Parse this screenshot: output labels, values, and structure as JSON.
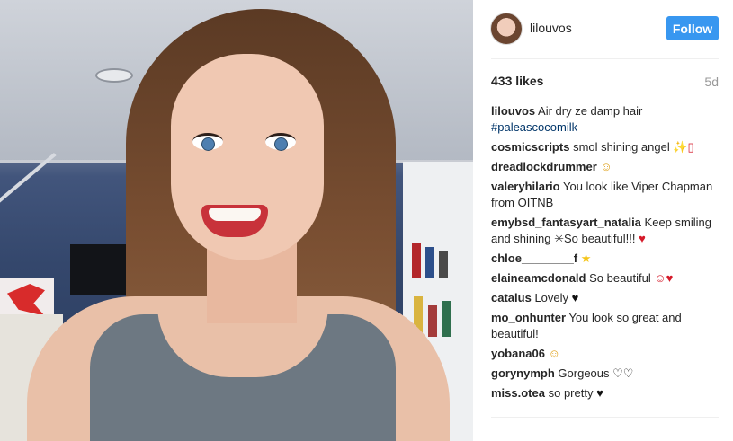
{
  "post": {
    "username": "lilouvos",
    "follow_label": "Follow",
    "likes": "433 likes",
    "age": "5d",
    "caption_user": "lilouvos",
    "caption_text": "Air dry ze damp hair",
    "hashtag": "#paleascocomilk"
  },
  "comments": [
    {
      "user": "cosmicscripts",
      "text": "smol shining angel",
      "emoji": "✨▯",
      "emoji_class": "emoji-heart"
    },
    {
      "user": "dreadlockdrummer",
      "text": "",
      "emoji": "☺",
      "emoji_class": "emoji-smile"
    },
    {
      "user": "valeryhilario",
      "text": "You look like Viper Chapman from OITNB",
      "emoji": "",
      "emoji_class": ""
    },
    {
      "user": "emybsd_fantasyart_natalia",
      "text": "Keep smiling and shining ✳So beautiful!!!",
      "emoji": "♥",
      "emoji_class": "emoji-heart"
    },
    {
      "user": "chloe________f",
      "text": "",
      "emoji": "★",
      "emoji_class": "emoji-star"
    },
    {
      "user": "elaineamcdonald",
      "text": "So beautiful",
      "emoji": "☺♥",
      "emoji_class": "emoji-heart"
    },
    {
      "user": "catalus",
      "text": "Lovely",
      "emoji": "♥",
      "emoji_class": "emoji-black"
    },
    {
      "user": "mo_onhunter",
      "text": "You look so great and beautiful!",
      "emoji": "",
      "emoji_class": ""
    },
    {
      "user": "yobana06",
      "text": "",
      "emoji": "☺",
      "emoji_class": "emoji-smile"
    },
    {
      "user": "gorynymph",
      "text": "Gorgeous",
      "emoji": "♡♡",
      "emoji_class": "emoji-black"
    },
    {
      "user": "miss.otea",
      "text": "so pretty",
      "emoji": "♥",
      "emoji_class": "emoji-black"
    }
  ],
  "colors": {
    "accent": "#3897f0",
    "hashtag": "#003569",
    "muted": "#999999"
  }
}
